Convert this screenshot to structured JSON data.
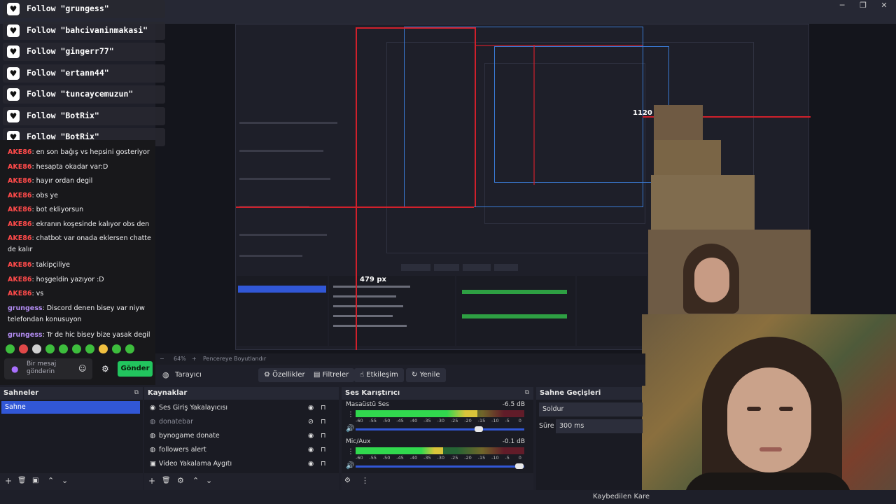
{
  "follows": [
    {
      "name": "Follow \"grungess\""
    },
    {
      "name": "Follow \"bahcivaninmakasi\""
    },
    {
      "name": "Follow \"gingerr77\""
    },
    {
      "name": "Follow \"ertann44\""
    },
    {
      "name": "Follow \"tuncaycemuzun\""
    },
    {
      "name": "Follow \"BotRix\""
    },
    {
      "name": "Follow \"BotRix\""
    }
  ],
  "chat": {
    "lines": [
      {
        "user": "AKE86",
        "text": ": en son bağış vs hepsini gosteriyor"
      },
      {
        "user": "AKE86",
        "text": ": hesapta okadar var:D"
      },
      {
        "user": "AKE86",
        "text": ": hayır ordan degil"
      },
      {
        "user": "AKE86",
        "text": ": obs ye"
      },
      {
        "user": "AKE86",
        "text": ": bot ekliyorsun"
      },
      {
        "user": "AKE86",
        "text": ": ekranın koşesinde kalıyor obs den"
      },
      {
        "user": "AKE86",
        "text": ": chatbot var onada eklersen chatte de kalır"
      },
      {
        "user": "AKE86",
        "text": ": takipçiliye"
      },
      {
        "user": "AKE86",
        "text": ": hoşgeldin yazıyor :D"
      },
      {
        "user": "AKE86",
        "text": ": vs"
      },
      {
        "user": "grungess",
        "text": ": Discord denen bisey var niyw telefondan konusuyon"
      },
      {
        "user": "grungess",
        "text": ": Tr de hic bisey bize yasak degil"
      }
    ],
    "input_placeholder": "Bir mesaj gönderin",
    "send_label": "Gönder"
  },
  "preview": {
    "dim_width": "1120 px",
    "dim_height": "479 px",
    "zoom": "64%",
    "fit_label": "Pencereye Boyutlandır"
  },
  "propbar": {
    "source_label": "Tarayıcı",
    "properties": "Özellikler",
    "filters": "Filtreler",
    "interact": "Etkileşim",
    "refresh": "Yenile"
  },
  "scenes": {
    "title": "Sahneler",
    "items": [
      "Sahne"
    ]
  },
  "sources": {
    "title": "Kaynaklar",
    "items": [
      {
        "label": "Ses Giriş Yakalayıcısı"
      },
      {
        "label": "donatebar"
      },
      {
        "label": "bynogame donate"
      },
      {
        "label": "followers alert"
      },
      {
        "label": "Video Yakalama Aygıtı"
      }
    ]
  },
  "mixer": {
    "title": "Ses Karıştırıcı",
    "channels": [
      {
        "name": "Masaüstü Ses",
        "db": "-6.5 dB",
        "level": 0.72
      },
      {
        "name": "Mic/Aux",
        "db": "-0.1 dB",
        "level": 0.52
      }
    ],
    "ticks": [
      "-60",
      "-55",
      "-50",
      "-45",
      "-40",
      "-35",
      "-30",
      "-25",
      "-20",
      "-15",
      "-10",
      "-5",
      "0"
    ]
  },
  "transitions": {
    "title": "Sahne Geçişleri",
    "selected": "Soldur",
    "duration_label": "Süre",
    "duration_value": "300 ms"
  },
  "status": {
    "dropped_frames": "Kaybedilen Kare"
  },
  "colors": {
    "accent_green": "#22c55e",
    "redline": "#d0202b",
    "selection_blue": "#3157d6",
    "username_red": "#ff4a4a",
    "username_purple": "#b28cf2"
  }
}
